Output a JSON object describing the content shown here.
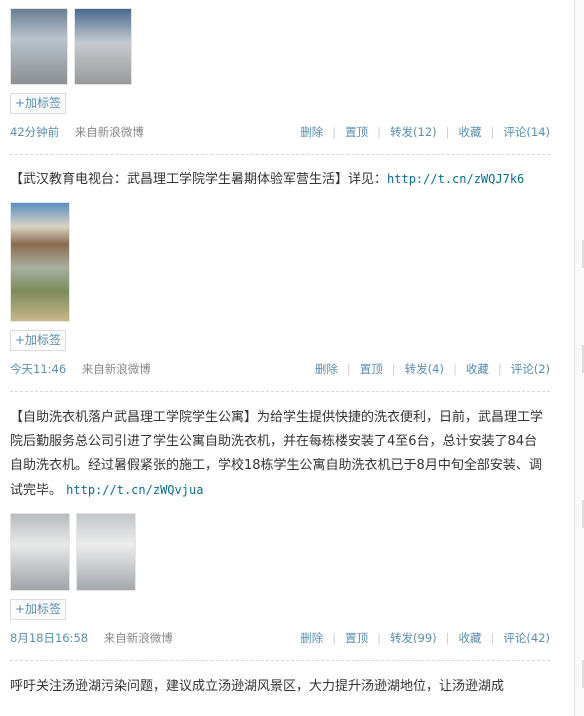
{
  "posts": [
    {
      "text_prefix": "",
      "link": "",
      "tag_button": "+加标签",
      "time": "42分钟前",
      "source": "来自新浪微博",
      "actions": [
        "删除",
        "置顶",
        "转发(12)",
        "收藏",
        "评论(14)"
      ]
    },
    {
      "text_prefix": "【武汉教育电视台：武昌理工学院学生暑期体验军营生活】详见：",
      "link": "http://t.cn/zWQJ7k6",
      "tag_button": "+加标签",
      "time": "今天11:46",
      "source": "来自新浪微博",
      "actions": [
        "删除",
        "置顶",
        "转发(4)",
        "收藏",
        "评论(2)"
      ]
    },
    {
      "text_prefix": "【自助洗衣机落户武昌理工学院学生公寓】为给学生提供快捷的洗衣便利，日前，武昌理工学院后勤服务总公司引进了学生公寓自助洗衣机，并在每栋楼安装了4至6台，总计安装了84台自助洗衣机。经过暑假紧张的施工，学校18栋学生公寓自助洗衣机已于8月中旬全部安装、调试完毕。",
      "link": "http://t.cn/zWQvjua",
      "tag_button": "+加标签",
      "time": "8月18日16:58",
      "source": "来自新浪微博",
      "actions": [
        "删除",
        "置顶",
        "转发(99)",
        "收藏",
        "评论(42)"
      ]
    },
    {
      "text_prefix": "呼吁关注汤逊湖污染问题，建议成立汤逊湖风景区，大力提升汤逊湖地位，让汤逊湖成"
    }
  ],
  "colors": {
    "link": "#0a6f8d",
    "meta_link": "#5a8fb0",
    "divider": "#d8d8d8"
  }
}
